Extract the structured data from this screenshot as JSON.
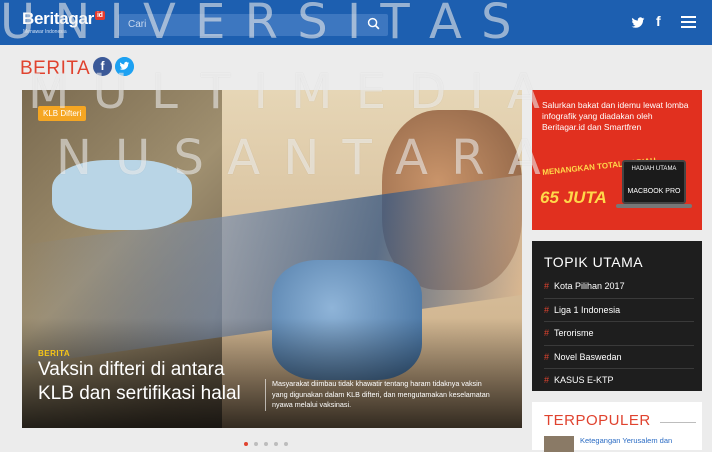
{
  "header": {
    "logo": "Beritagar",
    "logo_badge": "id",
    "logo_sub": "Menawar Indonesia",
    "search_placeholder": "Cari"
  },
  "section": {
    "title": "BERITA"
  },
  "hero": {
    "tag": "KLB Difteri",
    "kicker": "BERITA",
    "title": "Vaksin difteri di antara KLB dan sertifikasi halal",
    "description": "Masyarakat diimbau tidak khawatir tentang haram tidaknya vaksin yang digunakan dalam KLB difteri, dan mengutamakan keselamatan nyawa melalui vaksinasi."
  },
  "ad": {
    "text": "Salurkan bakat dan idemu lewat lomba infografik yang diadakan oleh Beritagar.id dan Smartfren",
    "win": "MENANGKAN TOTAL HADIAH",
    "amount": "65 JUTA",
    "prize_label": "HADIAH UTAMA",
    "prize": "MACBOOK PRO"
  },
  "topik": {
    "title": "TOPIK UTAMA",
    "items": [
      "Kota Pilihan 2017",
      "Liga 1 Indonesia",
      "Terorisme",
      "Novel Baswedan",
      "KASUS E-KTP"
    ]
  },
  "populer": {
    "title": "TERPOPULER",
    "first": "Ketegangan Yerusalem dan"
  },
  "watermark": {
    "line1": "U N I V E R S I T A S",
    "line2": "M U L T I M E D I A",
    "line3": "N U S A N T A R A"
  },
  "colors": {
    "header": "#1d5fb0",
    "accent": "#e0432f",
    "ad": "#e1301f",
    "topik_bg": "#1e1e1e"
  }
}
